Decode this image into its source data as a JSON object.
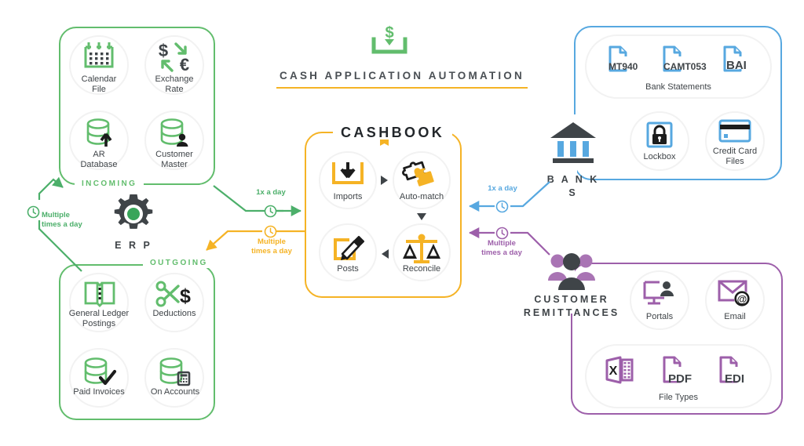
{
  "title": {
    "heading": "CASH APPLICATION AUTOMATION",
    "icon": "cash-deposit-icon"
  },
  "colors": {
    "green": "#62bd6d",
    "blue": "#57a8e0",
    "purple": "#9d5faa",
    "yellow": "#f5b325",
    "dark": "#3f4448",
    "pale": "#f2f2f2"
  },
  "erp": {
    "label": "E R P",
    "icon": "gear-icon"
  },
  "incoming": {
    "label": "INCOMING",
    "items": [
      {
        "label": "Calendar\nFile",
        "icon": "calendar-icon"
      },
      {
        "label": "Exchange\nRate",
        "icon": "currency-exchange-icon"
      },
      {
        "label": "AR\nDatabase",
        "icon": "database-up-arrow-icon"
      },
      {
        "label": "Customer\nMaster",
        "icon": "database-person-icon"
      }
    ]
  },
  "outgoing": {
    "label": "OUTGOING",
    "items": [
      {
        "label": "General Ledger\nPostings",
        "icon": "open-book-icon"
      },
      {
        "label": "Deductions",
        "icon": "scissors-dollar-icon"
      },
      {
        "label": "Paid Invoices",
        "icon": "database-check-icon"
      },
      {
        "label": "On Accounts",
        "icon": "database-calculator-icon"
      }
    ]
  },
  "cashbook": {
    "label": "CASHBOOK",
    "items": [
      {
        "label": "Imports",
        "icon": "import-tray-icon"
      },
      {
        "label": "Auto-match",
        "icon": "puzzle-pieces-icon"
      },
      {
        "label": "Posts",
        "icon": "edit-pencil-icon"
      },
      {
        "label": "Reconcile",
        "icon": "balance-scale-icon"
      }
    ]
  },
  "banks": {
    "label": "B A N K S",
    "icon": "bank-building-icon",
    "statements": {
      "group_label": "Bank Statements",
      "formats": [
        {
          "label": "MT940",
          "icon": "file-icon"
        },
        {
          "label": "CAMT053",
          "icon": "file-icon"
        },
        {
          "label": "BAI",
          "icon": "file-icon"
        }
      ]
    },
    "items": [
      {
        "label": "Lockbox",
        "icon": "padlock-icon"
      },
      {
        "label": "Credit Card\nFiles",
        "icon": "credit-card-icon"
      }
    ]
  },
  "remittances": {
    "label": "CUSTOMER\nREMITTANCES",
    "icon": "people-group-icon",
    "items": [
      {
        "label": "Portals",
        "icon": "monitor-user-icon"
      },
      {
        "label": "Email",
        "icon": "envelope-at-icon"
      }
    ],
    "file_types": {
      "group_label": "File Types",
      "formats": [
        {
          "label": "X",
          "icon": "excel-file-icon"
        },
        {
          "label": "PDF",
          "icon": "pdf-file-icon"
        },
        {
          "label": "EDI",
          "icon": "edi-file-icon"
        }
      ]
    }
  },
  "connectors": [
    {
      "id": "erp-in",
      "label": "Multiple\ntimes a day",
      "color": "green",
      "icon": "clock-icon"
    },
    {
      "id": "erp-to-cashbook",
      "label": "1x  a day",
      "color": "green",
      "icon": "clock-icon"
    },
    {
      "id": "cashbook-to-erp",
      "label": "Multiple\ntimes a day",
      "color": "yellow",
      "icon": "clock-icon"
    },
    {
      "id": "banks-to-cashbook",
      "label": "1x  a day",
      "color": "blue",
      "icon": "clock-icon"
    },
    {
      "id": "remittances-to-cashbook",
      "label": "Multiple\ntimes a day",
      "color": "purple",
      "icon": "clock-icon"
    }
  ]
}
